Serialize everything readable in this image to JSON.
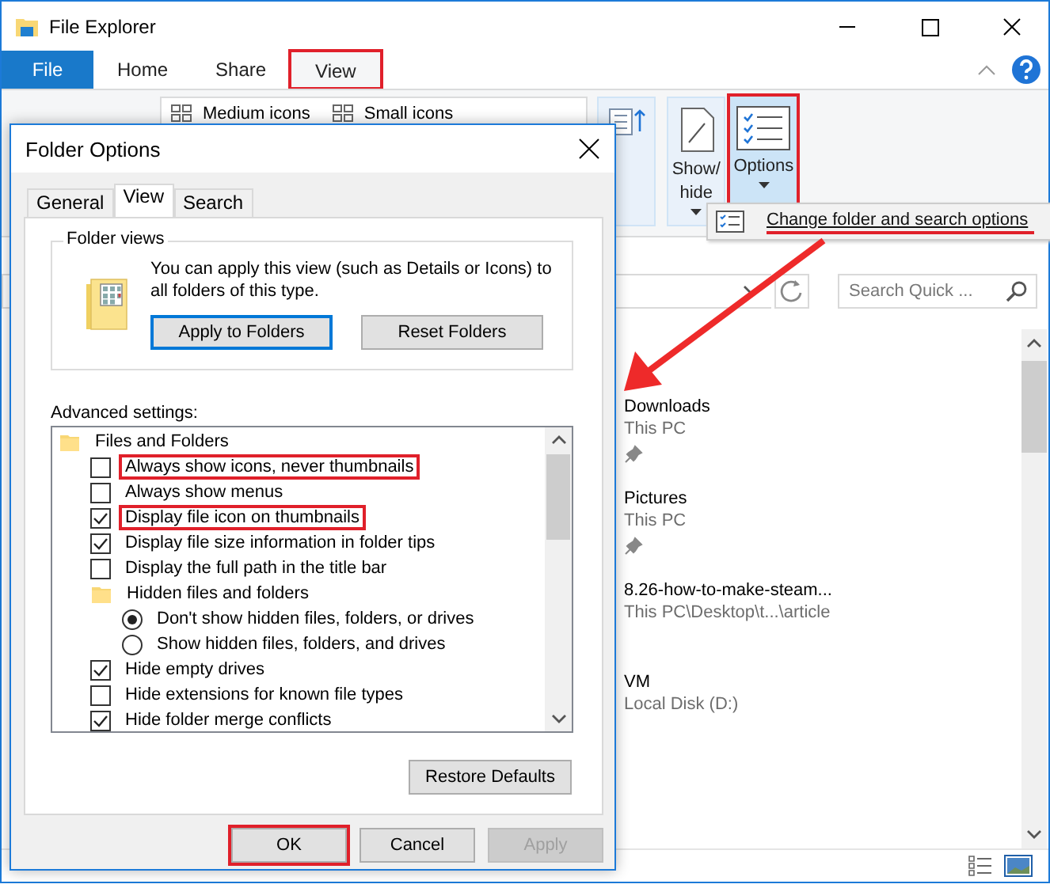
{
  "window": {
    "title": "File Explorer"
  },
  "ribbon_tabs": [
    {
      "label": "File",
      "kind": "file",
      "selected": false,
      "highlighted": false
    },
    {
      "label": "Home",
      "kind": "tab",
      "selected": false,
      "highlighted": false
    },
    {
      "label": "Share",
      "kind": "tab",
      "selected": false,
      "highlighted": false
    },
    {
      "label": "View",
      "kind": "tab",
      "selected": true,
      "highlighted": true
    }
  ],
  "ribbon": {
    "layouts": [
      "Medium icons",
      "Small icons"
    ],
    "buttons": [
      {
        "label": "Show/\nhide",
        "kind": "showhide",
        "dropdown": true,
        "selected": false,
        "highlighted": false
      },
      {
        "label": "Options",
        "kind": "options",
        "dropdown": true,
        "selected": true,
        "highlighted": true
      }
    ]
  },
  "options_menu": {
    "items": [
      {
        "label": "Change folder and search options",
        "underlined": true
      }
    ]
  },
  "search": {
    "placeholder": "Search Quick ..."
  },
  "quick_access": [
    {
      "name": "Downloads",
      "location": "This PC",
      "pinned": true
    },
    {
      "name": "Pictures",
      "location": "This PC",
      "pinned": true
    },
    {
      "name": "8.26-how-to-make-steam...",
      "location": "This PC\\Desktop\\t...\\article",
      "pinned": false
    },
    {
      "name": "VM",
      "location": "Local Disk (D:)",
      "pinned": false
    }
  ],
  "dialog": {
    "title": "Folder Options",
    "tabs": [
      {
        "label": "General",
        "selected": false
      },
      {
        "label": "View",
        "selected": true
      },
      {
        "label": "Search",
        "selected": false
      }
    ],
    "folder_views": {
      "legend": "Folder views",
      "text": "You can apply this view (such as Details or Icons) to all folders of this type.",
      "buttons": [
        {
          "label": "Apply to Folders",
          "focused": true
        },
        {
          "label": "Reset Folders",
          "focused": false
        }
      ]
    },
    "advanced_label": "Advanced settings:",
    "settings": [
      {
        "kind": "folder",
        "label": "Files and Folders",
        "children": [
          {
            "kind": "checkbox",
            "label": "Always show icons, never thumbnails",
            "checked": false,
            "highlighted": true
          },
          {
            "kind": "checkbox",
            "label": "Always show menus",
            "checked": false,
            "highlighted": false
          },
          {
            "kind": "checkbox",
            "label": "Display file icon on thumbnails",
            "checked": true,
            "highlighted": true
          },
          {
            "kind": "checkbox",
            "label": "Display file size information in folder tips",
            "checked": true,
            "highlighted": false
          },
          {
            "kind": "checkbox",
            "label": "Display the full path in the title bar",
            "checked": false,
            "highlighted": false
          },
          {
            "kind": "folder",
            "label": "Hidden files and folders",
            "children": [
              {
                "kind": "radio",
                "label": "Don't show hidden files, folders, or drives",
                "selected": true,
                "highlighted": false
              },
              {
                "kind": "radio",
                "label": "Show hidden files, folders, and drives",
                "selected": false,
                "highlighted": false
              }
            ]
          },
          {
            "kind": "checkbox",
            "label": "Hide empty drives",
            "checked": true,
            "highlighted": false
          },
          {
            "kind": "checkbox",
            "label": "Hide extensions for known file types",
            "checked": false,
            "highlighted": false
          },
          {
            "kind": "checkbox",
            "label": "Hide folder merge conflicts",
            "checked": true,
            "highlighted": false
          }
        ]
      }
    ],
    "restore_button": "Restore Defaults",
    "buttons": [
      {
        "label": "OK",
        "disabled": false,
        "highlighted": true
      },
      {
        "label": "Cancel",
        "disabled": false,
        "highlighted": false
      },
      {
        "label": "Apply",
        "disabled": true,
        "highlighted": false
      }
    ]
  }
}
